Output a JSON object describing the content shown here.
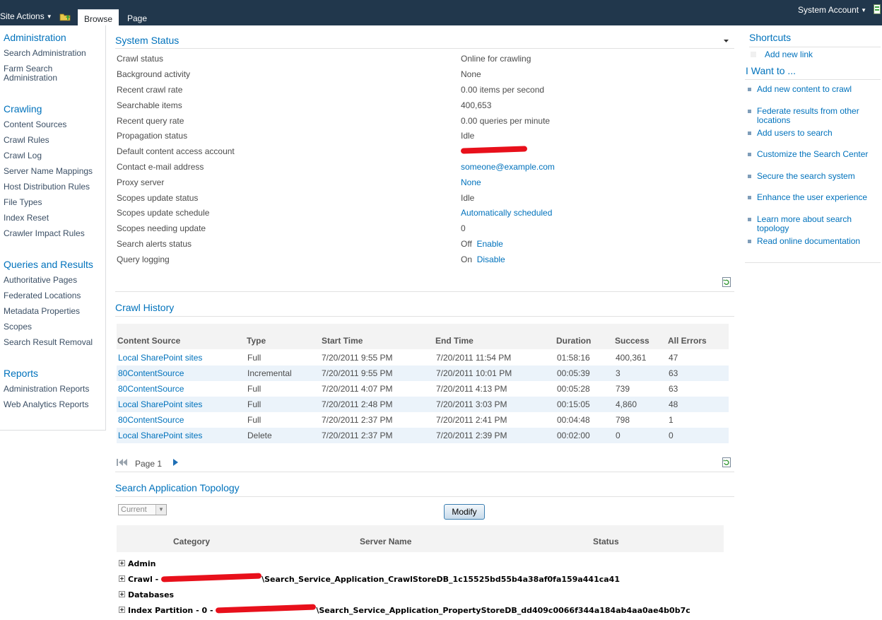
{
  "ribbon": {
    "site_actions": "Site Actions",
    "tabs": [
      "Browse",
      "Page"
    ],
    "user": "System Account"
  },
  "quicklaunch": {
    "sections": [
      {
        "heading": "Administration",
        "items": [
          "Search Administration",
          "Farm Search Administration"
        ]
      },
      {
        "heading": "Crawling",
        "items": [
          "Content Sources",
          "Crawl Rules",
          "Crawl Log",
          "Server Name Mappings",
          "Host Distribution Rules",
          "File Types",
          "Index Reset",
          "Crawler Impact Rules"
        ]
      },
      {
        "heading": "Queries and Results",
        "items": [
          "Authoritative Pages",
          "Federated Locations",
          "Metadata Properties",
          "Scopes",
          "Search Result Removal"
        ]
      },
      {
        "heading": "Reports",
        "items": [
          "Administration Reports",
          "Web Analytics Reports"
        ]
      }
    ]
  },
  "system_status": {
    "title": "System Status",
    "rows": [
      {
        "label": "Crawl status",
        "value": "Online for crawling"
      },
      {
        "label": "Background activity",
        "value": "None"
      },
      {
        "label": "Recent crawl rate",
        "value": "0.00 items per second"
      },
      {
        "label": "Searchable items",
        "value": "400,653"
      },
      {
        "label": "Recent query rate",
        "value": "0.00 queries per minute"
      },
      {
        "label": "Propagation status",
        "value": "Idle"
      },
      {
        "label": "Default content access account",
        "value": ""
      },
      {
        "label": "Contact e-mail address",
        "value": "someone@example.com"
      },
      {
        "label": "Proxy server",
        "value": "None"
      },
      {
        "label": "Scopes update status",
        "value": "Idle"
      },
      {
        "label": "Scopes update schedule",
        "value": "Automatically scheduled"
      },
      {
        "label": "Scopes needing update",
        "value": "0"
      },
      {
        "label": "Search alerts status",
        "value": "Off",
        "action": "Enable"
      },
      {
        "label": "Query logging",
        "value": "On",
        "action": "Disable"
      }
    ]
  },
  "crawl_history": {
    "title": "Crawl History",
    "columns": [
      "Content Source",
      "Type",
      "Start Time",
      "End Time",
      "Duration",
      "Success",
      "All Errors"
    ],
    "rows": [
      [
        "Local SharePoint sites",
        "Full",
        "7/20/2011 9:55 PM",
        "7/20/2011 11:54 PM",
        "01:58:16",
        "400,361",
        "47"
      ],
      [
        "80ContentSource",
        "Incremental",
        "7/20/2011 9:55 PM",
        "7/20/2011 10:01 PM",
        "00:05:39",
        "3",
        "63"
      ],
      [
        "80ContentSource",
        "Full",
        "7/20/2011 4:07 PM",
        "7/20/2011 4:13 PM",
        "00:05:28",
        "739",
        "63"
      ],
      [
        "Local SharePoint sites",
        "Full",
        "7/20/2011 2:48 PM",
        "7/20/2011 3:03 PM",
        "00:15:05",
        "4,860",
        "48"
      ],
      [
        "80ContentSource",
        "Full",
        "7/20/2011 2:37 PM",
        "7/20/2011 2:41 PM",
        "00:04:48",
        "798",
        "1"
      ],
      [
        "Local SharePoint sites",
        "Delete",
        "7/20/2011 2:37 PM",
        "7/20/2011 2:39 PM",
        "00:02:00",
        "0",
        "0"
      ]
    ],
    "pager": "Page 1"
  },
  "topology": {
    "title": "Search Application Topology",
    "select_value": "Current",
    "modify_label": "Modify",
    "columns": [
      "Category",
      "Server Name",
      "Status"
    ],
    "rows": [
      {
        "prefix": "Admin",
        "suffix": ""
      },
      {
        "prefix": "Crawl - ",
        "suffix": "\\Search_Service_Application_CrawlStoreDB_1c15525bd55b4a38af0fa159a441ca41"
      },
      {
        "prefix": "Databases",
        "suffix": ""
      },
      {
        "prefix": "Index Partition - 0 - ",
        "suffix": "\\Search_Service_Application_PropertyStoreDB_dd409c0066f344a184ab4aa0ae4b0b7c"
      }
    ]
  },
  "shortcuts": {
    "title": "Shortcuts",
    "add_link": "Add new link"
  },
  "i_want_to": {
    "title": "I Want to ...",
    "links": [
      "Add new content to crawl",
      "Federate results from other locations",
      "Add users to search",
      "Customize the Search Center",
      "Secure the search system",
      "Enhance the user experience",
      "Learn more about search topology",
      "Read online documentation"
    ]
  }
}
